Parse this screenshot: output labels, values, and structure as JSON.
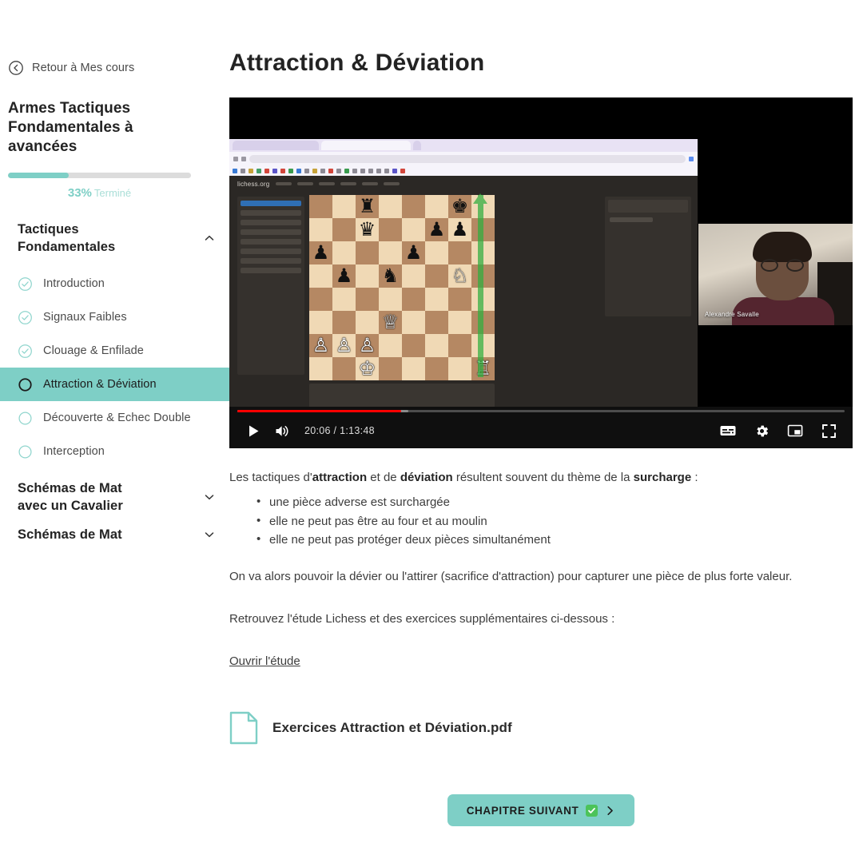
{
  "sidebar": {
    "back": {
      "label": "Retour à Mes cours",
      "icon": "circle-arrow-left-icon"
    },
    "course_title": "Armes Tactiques Fondamentales à avancées",
    "progress": {
      "percent": 33,
      "percent_label": "33%",
      "word": "Terminé"
    },
    "sections": [
      {
        "title": "Tactiques Fondamentales",
        "expanded": true,
        "chevron": "chevron-up-icon",
        "lessons": [
          {
            "label": "Introduction",
            "state": "done"
          },
          {
            "label": "Signaux Faibles",
            "state": "done"
          },
          {
            "label": "Clouage & Enfilade",
            "state": "done"
          },
          {
            "label": "Attraction & Déviation",
            "state": "active"
          },
          {
            "label": "Découverte & Echec Double",
            "state": "todo"
          },
          {
            "label": "Interception",
            "state": "todo"
          }
        ]
      },
      {
        "title": "Schémas de Mat avec un Cavalier",
        "expanded": false,
        "chevron": "chevron-down-icon",
        "lessons": []
      },
      {
        "title": "Schémas de Mat",
        "expanded": false,
        "chevron": "chevron-down-icon",
        "lessons": []
      }
    ]
  },
  "main": {
    "page_title": "Attraction & Déviation",
    "video": {
      "current_time": "20:06",
      "duration": "1:13:48",
      "time_label": "20:06 / 1:13:48",
      "progress_percent": 27,
      "webcam_name": "Alexandre Savalle",
      "site_logo_text": "lichess.org",
      "controls": {
        "play": "play-button",
        "volume": "volume-button",
        "captions": "captions-button",
        "settings": "settings-gear-button",
        "miniplayer": "miniplayer-button",
        "fullscreen": "fullscreen-button"
      }
    },
    "text": {
      "intro_pre": "Les tactiques d'",
      "intro_b1": "attraction",
      "intro_mid": " et de ",
      "intro_b2": "déviation",
      "intro_mid2": " résultent souvent du thème de la ",
      "intro_b3": "surcharge",
      "intro_end": " :",
      "bullets": [
        "une pièce adverse est surchargée",
        "elle ne peut pas être au four et au moulin",
        "elle ne peut pas protéger deux pièces simultanément"
      ],
      "para2": "On va alors pouvoir la dévier ou l'attirer (sacrifice d'attraction) pour capturer une pièce de plus forte valeur.",
      "para3": "Retrouvez l'étude Lichess et des exercices supplémentaires ci-dessous :",
      "study_link": "Ouvrir l'étude"
    },
    "attachment": {
      "name": "Exercices Attraction et Déviation.pdf",
      "icon": "file-document-icon"
    },
    "next_button": {
      "label": "CHAPITRE SUIVANT",
      "badge": "check-emoji",
      "chevron": "chevron-right-icon"
    }
  },
  "colors": {
    "accent_teal": "#7ecfc6",
    "progress_track": "#dcdcdc",
    "youtube_red": "#ff0000",
    "board_light": "#f0d9b5",
    "board_dark": "#b58863",
    "arrow_green": "#2fae3f"
  },
  "chess_position": {
    "description": "Position shown in the lichess study inside the video",
    "pieces": [
      {
        "square": "c8",
        "piece": "♜",
        "color": "black"
      },
      {
        "square": "g8",
        "piece": "♚",
        "color": "black"
      },
      {
        "square": "c7",
        "piece": "♛",
        "color": "black"
      },
      {
        "square": "f7",
        "piece": "♟",
        "color": "black"
      },
      {
        "square": "g7",
        "piece": "♟",
        "color": "black"
      },
      {
        "square": "a6",
        "piece": "♟",
        "color": "black"
      },
      {
        "square": "e6",
        "piece": "♟",
        "color": "black"
      },
      {
        "square": "b5",
        "piece": "♟",
        "color": "black"
      },
      {
        "square": "d5",
        "piece": "♞",
        "color": "black"
      },
      {
        "square": "g5",
        "piece": "♘",
        "color": "white"
      },
      {
        "square": "d3",
        "piece": "♕",
        "color": "white"
      },
      {
        "square": "a2",
        "piece": "♙",
        "color": "white"
      },
      {
        "square": "b2",
        "piece": "♙",
        "color": "white"
      },
      {
        "square": "c2",
        "piece": "♙",
        "color": "white"
      },
      {
        "square": "c1",
        "piece": "♔",
        "color": "white"
      },
      {
        "square": "h1",
        "piece": "♖",
        "color": "white"
      }
    ]
  }
}
